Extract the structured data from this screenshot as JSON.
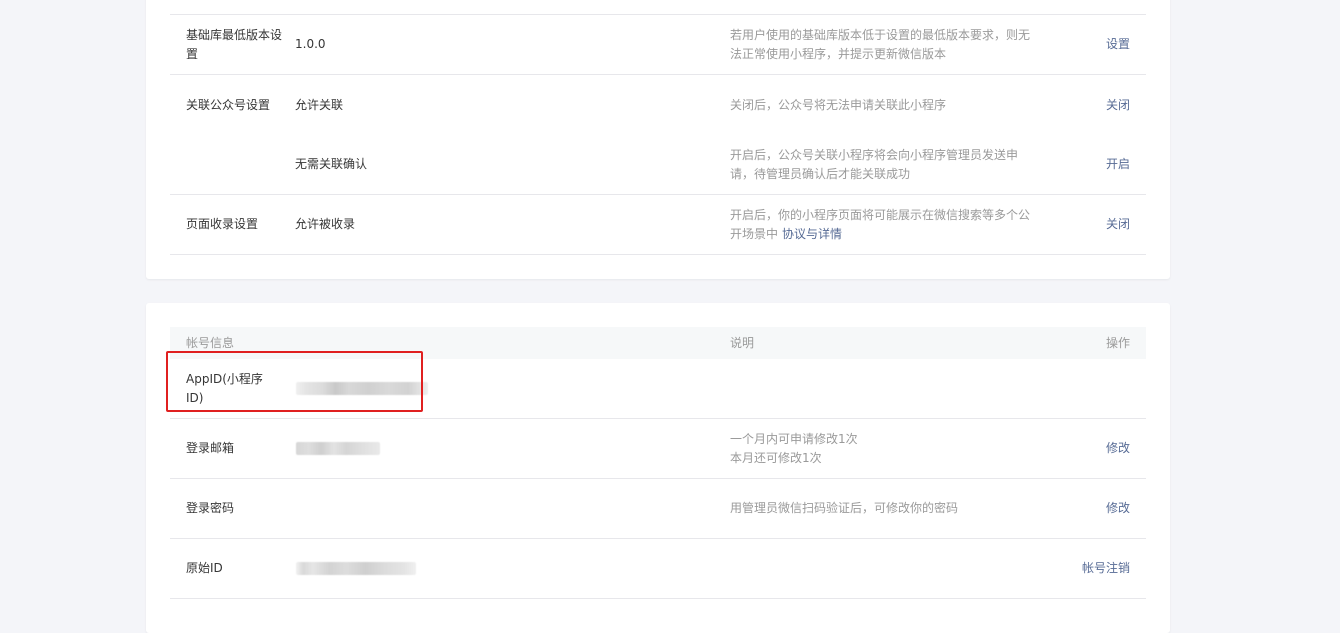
{
  "colors": {
    "link": "#576b95",
    "muted_text": "#9a9a9a",
    "highlight": "#e02020"
  },
  "settings": {
    "rows": [
      {
        "label": "基础库最低版本设置",
        "value": "1.0.0",
        "desc": "若用户使用的基础库版本低于设置的最低版本要求，则无法正常使用小程序，并提示更新微信版本",
        "op": "设置"
      },
      {
        "label": "关联公众号设置",
        "value": "允许关联",
        "desc": "关闭后，公众号将无法申请关联此小程序",
        "op": "关闭"
      },
      {
        "label": "",
        "value": "无需关联确认",
        "desc": "开启后，公众号关联小程序将会向小程序管理员发送申请，待管理员确认后才能关联成功",
        "op": "开启"
      },
      {
        "label": "页面收录设置",
        "value": "允许被收录",
        "desc": "开启后，你的小程序页面将可能展示在微信搜索等多个公开场景中",
        "desc_link": "协议与详情",
        "op": "关闭"
      }
    ]
  },
  "account": {
    "header": {
      "col1": "帐号信息",
      "col2": "说明",
      "col3": "操作"
    },
    "rows": [
      {
        "label": "AppID(小程序ID)",
        "desc": "",
        "op": ""
      },
      {
        "label": "登录邮箱",
        "desc_line1": "一个月内可申请修改1次",
        "desc_line2": "本月还可修改1次",
        "op": "修改"
      },
      {
        "label": "登录密码",
        "desc": "用管理员微信扫码验证后，可修改你的密码",
        "op": "修改"
      },
      {
        "label": "原始ID",
        "desc": "",
        "op": "帐号注销"
      }
    ]
  }
}
